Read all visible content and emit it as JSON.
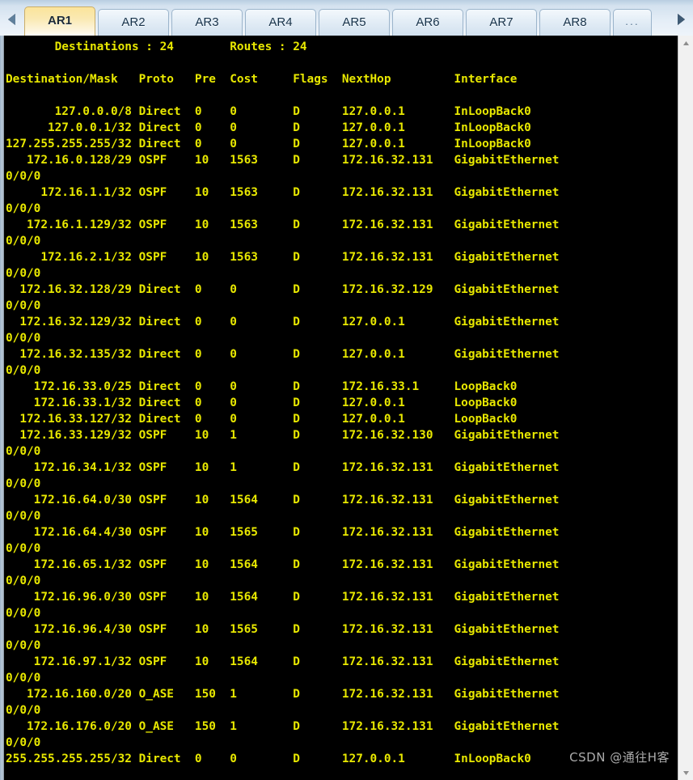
{
  "tabbar": {
    "scroll_left_icon": "triangle-left-icon",
    "scroll_right_icon": "triangle-right-icon",
    "tabs": [
      {
        "label": "AR1",
        "active": true
      },
      {
        "label": "AR2",
        "active": false
      },
      {
        "label": "AR3",
        "active": false
      },
      {
        "label": "AR4",
        "active": false
      },
      {
        "label": "AR5",
        "active": false
      },
      {
        "label": "AR6",
        "active": false
      },
      {
        "label": "AR7",
        "active": false
      },
      {
        "label": "AR8",
        "active": false
      },
      {
        "label": "...",
        "active": false
      }
    ]
  },
  "terminal": {
    "text_color": "#e8e800",
    "background_color": "#000000",
    "summary": {
      "destinations_label": "Destinations",
      "destinations_value": "24",
      "routes_label": "Routes",
      "routes_value": "24"
    },
    "columns": [
      "Destination/Mask",
      "Proto",
      "Pre",
      "Cost",
      "Flags",
      "NextHop",
      "Interface"
    ],
    "rows": [
      {
        "destination": "127.0.0.0/8",
        "proto": "Direct",
        "pre": "0",
        "cost": "0",
        "flags": "D",
        "nexthop": "127.0.0.1",
        "interface": "InLoopBack0"
      },
      {
        "destination": "127.0.0.1/32",
        "proto": "Direct",
        "pre": "0",
        "cost": "0",
        "flags": "D",
        "nexthop": "127.0.0.1",
        "interface": "InLoopBack0"
      },
      {
        "destination": "127.255.255.255/32",
        "proto": "Direct",
        "pre": "0",
        "cost": "0",
        "flags": "D",
        "nexthop": "127.0.0.1",
        "interface": "InLoopBack0"
      },
      {
        "destination": "172.16.0.128/29",
        "proto": "OSPF",
        "pre": "10",
        "cost": "1563",
        "flags": "D",
        "nexthop": "172.16.32.131",
        "interface": "GigabitEthernet0/0/0"
      },
      {
        "destination": "172.16.1.1/32",
        "proto": "OSPF",
        "pre": "10",
        "cost": "1563",
        "flags": "D",
        "nexthop": "172.16.32.131",
        "interface": "GigabitEthernet0/0/0"
      },
      {
        "destination": "172.16.1.129/32",
        "proto": "OSPF",
        "pre": "10",
        "cost": "1563",
        "flags": "D",
        "nexthop": "172.16.32.131",
        "interface": "GigabitEthernet0/0/0"
      },
      {
        "destination": "172.16.2.1/32",
        "proto": "OSPF",
        "pre": "10",
        "cost": "1563",
        "flags": "D",
        "nexthop": "172.16.32.131",
        "interface": "GigabitEthernet0/0/0"
      },
      {
        "destination": "172.16.32.128/29",
        "proto": "Direct",
        "pre": "0",
        "cost": "0",
        "flags": "D",
        "nexthop": "172.16.32.129",
        "interface": "GigabitEthernet0/0/0"
      },
      {
        "destination": "172.16.32.129/32",
        "proto": "Direct",
        "pre": "0",
        "cost": "0",
        "flags": "D",
        "nexthop": "127.0.0.1",
        "interface": "GigabitEthernet0/0/0"
      },
      {
        "destination": "172.16.32.135/32",
        "proto": "Direct",
        "pre": "0",
        "cost": "0",
        "flags": "D",
        "nexthop": "127.0.0.1",
        "interface": "GigabitEthernet0/0/0"
      },
      {
        "destination": "172.16.33.0/25",
        "proto": "Direct",
        "pre": "0",
        "cost": "0",
        "flags": "D",
        "nexthop": "172.16.33.1",
        "interface": "LoopBack0"
      },
      {
        "destination": "172.16.33.1/32",
        "proto": "Direct",
        "pre": "0",
        "cost": "0",
        "flags": "D",
        "nexthop": "127.0.0.1",
        "interface": "LoopBack0"
      },
      {
        "destination": "172.16.33.127/32",
        "proto": "Direct",
        "pre": "0",
        "cost": "0",
        "flags": "D",
        "nexthop": "127.0.0.1",
        "interface": "LoopBack0"
      },
      {
        "destination": "172.16.33.129/32",
        "proto": "OSPF",
        "pre": "10",
        "cost": "1",
        "flags": "D",
        "nexthop": "172.16.32.130",
        "interface": "GigabitEthernet0/0/0"
      },
      {
        "destination": "172.16.34.1/32",
        "proto": "OSPF",
        "pre": "10",
        "cost": "1",
        "flags": "D",
        "nexthop": "172.16.32.131",
        "interface": "GigabitEthernet0/0/0"
      },
      {
        "destination": "172.16.64.0/30",
        "proto": "OSPF",
        "pre": "10",
        "cost": "1564",
        "flags": "D",
        "nexthop": "172.16.32.131",
        "interface": "GigabitEthernet0/0/0"
      },
      {
        "destination": "172.16.64.4/30",
        "proto": "OSPF",
        "pre": "10",
        "cost": "1565",
        "flags": "D",
        "nexthop": "172.16.32.131",
        "interface": "GigabitEthernet0/0/0"
      },
      {
        "destination": "172.16.65.1/32",
        "proto": "OSPF",
        "pre": "10",
        "cost": "1564",
        "flags": "D",
        "nexthop": "172.16.32.131",
        "interface": "GigabitEthernet0/0/0"
      },
      {
        "destination": "172.16.96.0/30",
        "proto": "OSPF",
        "pre": "10",
        "cost": "1564",
        "flags": "D",
        "nexthop": "172.16.32.131",
        "interface": "GigabitEthernet0/0/0"
      },
      {
        "destination": "172.16.96.4/30",
        "proto": "OSPF",
        "pre": "10",
        "cost": "1565",
        "flags": "D",
        "nexthop": "172.16.32.131",
        "interface": "GigabitEthernet0/0/0"
      },
      {
        "destination": "172.16.97.1/32",
        "proto": "OSPF",
        "pre": "10",
        "cost": "1564",
        "flags": "D",
        "nexthop": "172.16.32.131",
        "interface": "GigabitEthernet0/0/0"
      },
      {
        "destination": "172.16.160.0/20",
        "proto": "O_ASE",
        "pre": "150",
        "cost": "1",
        "flags": "D",
        "nexthop": "172.16.32.131",
        "interface": "GigabitEthernet0/0/0"
      },
      {
        "destination": "172.16.176.0/20",
        "proto": "O_ASE",
        "pre": "150",
        "cost": "1",
        "flags": "D",
        "nexthop": "172.16.32.131",
        "interface": "GigabitEthernet0/0/0"
      },
      {
        "destination": "255.255.255.255/32",
        "proto": "Direct",
        "pre": "0",
        "cost": "0",
        "flags": "D",
        "nexthop": "127.0.0.1",
        "interface": "InLoopBack0"
      }
    ]
  },
  "watermark": {
    "text": "CSDN @通往H客"
  }
}
